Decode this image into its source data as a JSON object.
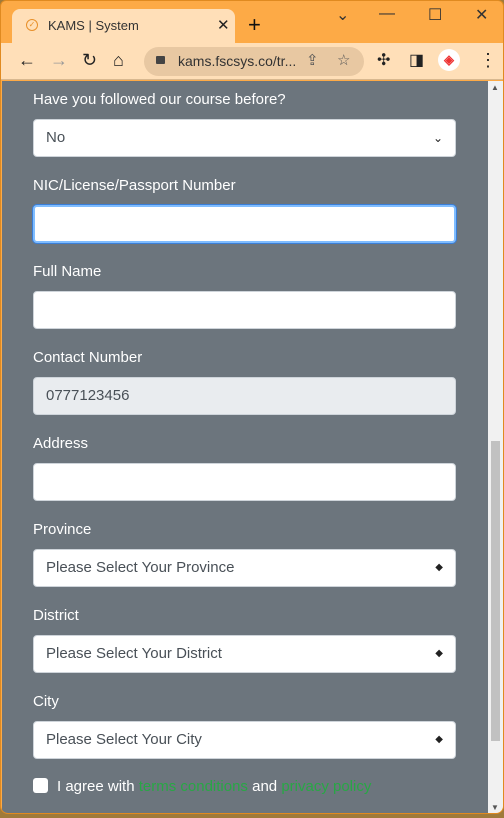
{
  "browser": {
    "tab_title": "KAMS | System",
    "url": "kams.fscsys.co/tr..."
  },
  "form": {
    "course_label": "Have you followed our course before?",
    "course_value": "No",
    "nic_label": "NIC/License/Passport Number",
    "nic_value": "",
    "name_label": "Full Name",
    "name_value": "",
    "contact_label": "Contact Number",
    "contact_value": "0777123456",
    "address_label": "Address",
    "address_value": "",
    "province_label": "Province",
    "province_value": "Please Select Your Province",
    "district_label": "District",
    "district_value": "Please Select Your District",
    "city_label": "City",
    "city_value": "Please Select Your City",
    "agree_prefix": "I agree with",
    "terms_link": "terms conditions",
    "and": "and",
    "privacy_link": "privacy policy"
  },
  "colors": {
    "page_bg": "#6c757d",
    "link": "#28a745",
    "chrome": "#fdaa46"
  }
}
